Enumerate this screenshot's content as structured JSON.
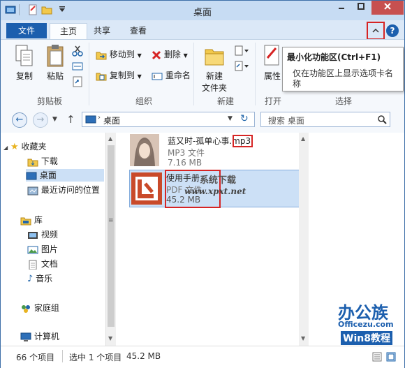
{
  "window": {
    "title": "桌面"
  },
  "tabs": [
    {
      "label": "文件"
    },
    {
      "label": "主页"
    },
    {
      "label": "共享"
    },
    {
      "label": "查看"
    }
  ],
  "ribbon": {
    "clipboard": {
      "copy": "复制",
      "paste": "粘贴",
      "group": "剪贴板"
    },
    "organize": {
      "move_to": "移动到",
      "copy_to": "复制到",
      "delete": "删除",
      "rename": "重命名",
      "group": "组织"
    },
    "new": {
      "new_folder_line1": "新建",
      "new_folder_line2": "文件夹",
      "group": "新建"
    },
    "open": {
      "properties": "属性",
      "group": "打开"
    },
    "select": {
      "group": "选择"
    }
  },
  "tooltip": {
    "title": "最小化功能区(Ctrl+F1)",
    "description": "仅在功能区上显示选项卡名称"
  },
  "address": {
    "path": "桌面",
    "search_placeholder": "搜索 桌面"
  },
  "nav": {
    "favorites": "收藏夹",
    "downloads": "下载",
    "desktop": "桌面",
    "recent": "最近访问的位置",
    "libraries": "库",
    "videos": "视频",
    "pictures": "图片",
    "documents": "文档",
    "music": "音乐",
    "homegroup": "家庭组",
    "computer": "计算机"
  },
  "files": [
    {
      "name_main": "蓝又时-孤单心事",
      "name_ext": ".mp3",
      "type": "MP3 文件",
      "size": "7.16 MB"
    },
    {
      "name_main": "使用手册",
      "type": "PDF 文件",
      "size": "45.2 MB"
    }
  ],
  "watermarks": {
    "site1": "系统下载",
    "site1_url": "www.xpxt.net",
    "brand_cn": "办公族",
    "brand_url": "Officezu.com",
    "brand_tag": "Win8教程"
  },
  "status": {
    "count": "66 个项目",
    "selected": "选中 1 个项目",
    "size": "45.2 MB"
  },
  "colors": {
    "accent": "#1c5fae",
    "annotation": "#d62424",
    "selection": "#cce0f6"
  }
}
